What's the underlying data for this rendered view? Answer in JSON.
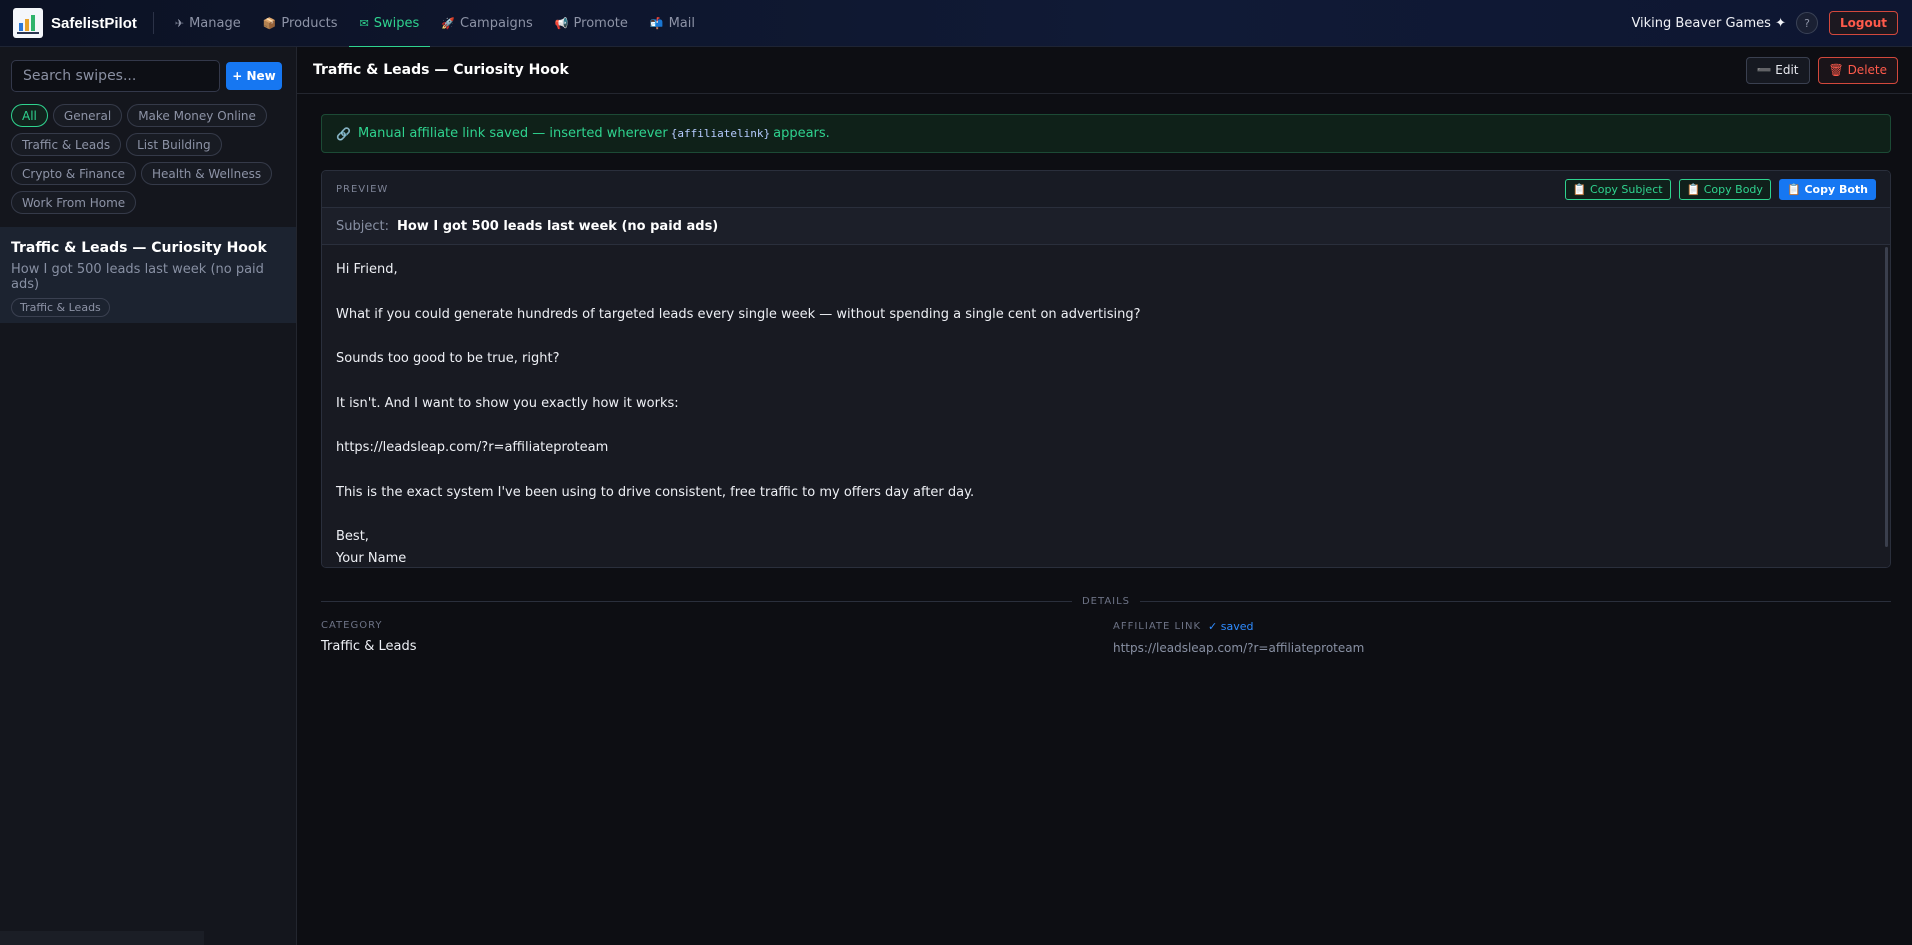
{
  "app": {
    "brand": "SafelistPilot",
    "user": "Viking Beaver Games ✦",
    "help": "?",
    "logout": "Logout"
  },
  "nav": [
    {
      "icon": "✈",
      "label": "Manage"
    },
    {
      "icon": "📦",
      "label": "Products"
    },
    {
      "icon": "✉",
      "label": "Swipes"
    },
    {
      "icon": "🚀",
      "label": "Campaigns"
    },
    {
      "icon": "📢",
      "label": "Promote"
    },
    {
      "icon": "📬",
      "label": "Mail"
    }
  ],
  "sidebar": {
    "search_placeholder": "Search swipes...",
    "new_label": "+ New",
    "chips": [
      "All",
      "General",
      "Make Money Online",
      "Traffic & Leads",
      "List Building",
      "Crypto & Finance",
      "Health & Wellness",
      "Work From Home"
    ],
    "selected_item": {
      "title": "Traffic & Leads — Curiosity Hook",
      "subject": "How I got 500 leads last week (no paid ads)",
      "tag": "Traffic & Leads"
    }
  },
  "main": {
    "title": "Traffic & Leads — Curiosity Hook",
    "edit_label": "➖ Edit",
    "delete_label": "🗑 Delete",
    "notice": {
      "icon": "🔗",
      "before": "Manual affiliate link saved — inserted wherever",
      "code": "{affiliatelink}",
      "after": "appears."
    },
    "preview": {
      "label": "PREVIEW",
      "copy_subject": "📋 Copy Subject",
      "copy_body": "📋 Copy Body",
      "copy_both": "📋 Copy Both",
      "subject_label": "Subject:",
      "subject_value": "How I got 500 leads last week (no paid ads)",
      "body": [
        "Hi Friend,",
        "What if you could generate hundreds of targeted leads every single week — without spending a single cent on advertising?",
        "Sounds too good to be true, right?",
        "It isn't. And I want to show you exactly how it works:",
        "https://leadsleap.com/?r=affiliateproteam",
        "This is the exact system I've been using to drive consistent, free traffic to my offers day after day.",
        "Best,",
        "Your Name"
      ]
    },
    "details": {
      "label": "DETAILS",
      "category_label": "CATEGORY",
      "category_value": "Traffic & Leads",
      "affiliate_label": "AFFILIATE LINK",
      "affiliate_saved": "✓ saved",
      "affiliate_value": "https://leadsleap.com/?r=affiliateproteam"
    }
  }
}
